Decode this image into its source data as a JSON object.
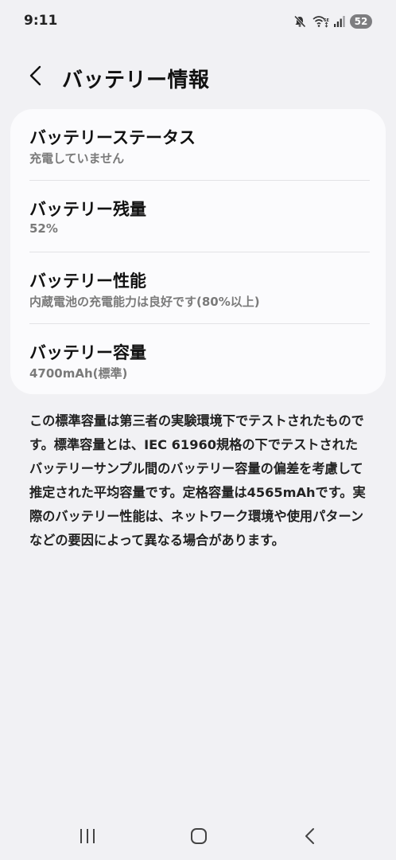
{
  "status_bar": {
    "time": "9:11",
    "battery_level": "52",
    "icons": [
      "mute-icon",
      "wifi-6e-icon",
      "signal-icon",
      "battery-icon"
    ]
  },
  "header": {
    "back_icon": "chevron-left-icon",
    "title": "バッテリー情報"
  },
  "items": [
    {
      "title": "バッテリーステータス",
      "value": "充電していません"
    },
    {
      "title": "バッテリー残量",
      "value": "52%"
    },
    {
      "title": "バッテリー性能",
      "value": "内蔵電池の充電能力は良好です(80%以上)"
    },
    {
      "title": "バッテリー容量",
      "value": "4700mAh(標準)"
    }
  ],
  "description": "この標準容量は第三者の実験環境下でテストされたものです。標準容量とは、IEC 61960規格の下でテストされたバッテリーサンプル間のバッテリー容量の偏差を考慮して推定された平均容量です。定格容量は4565mAhです。実際のバッテリー性能は、ネットワーク環境や使用パターンなどの要因によって異なる場合があります。",
  "nav_bar": {
    "buttons": [
      "recent-apps-icon",
      "home-icon",
      "back-icon"
    ]
  }
}
